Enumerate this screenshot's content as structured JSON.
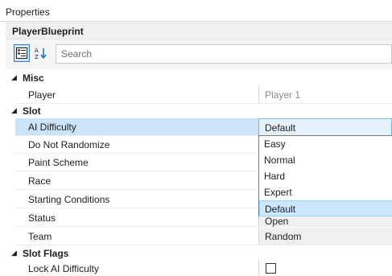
{
  "window": {
    "title": "Properties"
  },
  "object": {
    "name": "PlayerBlueprint"
  },
  "toolbar": {
    "categorized_icon": "categorized-icon",
    "alphabetical_icon": "sort-alphabetical-icon",
    "search_placeholder": "Search"
  },
  "categories": {
    "misc": "Misc",
    "slot": "Slot",
    "slot_flags": "Slot Flags"
  },
  "properties": {
    "player": {
      "name": "Player",
      "value": "Player 1"
    },
    "ai_difficulty": {
      "name": "AI Difficulty",
      "value": "Default"
    },
    "do_not_randomize": {
      "name": "Do Not Randomize"
    },
    "paint_scheme": {
      "name": "Paint Scheme"
    },
    "race": {
      "name": "Race"
    },
    "starting_conditions": {
      "name": "Starting Conditions"
    },
    "status": {
      "name": "Status",
      "value": "Open"
    },
    "team": {
      "name": "Team",
      "value": "Random"
    },
    "lock_ai_difficulty": {
      "name": "Lock AI Difficulty",
      "checked": false
    }
  },
  "dropdown": {
    "options": [
      "Easy",
      "Normal",
      "Hard",
      "Expert",
      "Default"
    ],
    "highlighted": "Default"
  },
  "colors": {
    "selection": "#cce4f7",
    "accent": "#3b7bd1",
    "category_bg": "#f0f0f0"
  }
}
